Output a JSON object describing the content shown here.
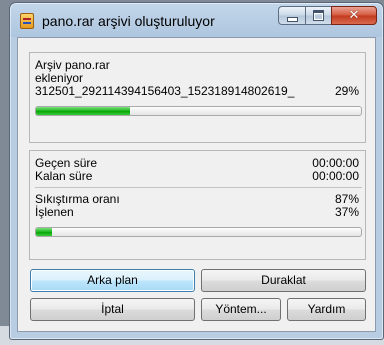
{
  "window": {
    "title": "pano.rar arşivi oluşturuluyor"
  },
  "icons": {
    "app": "winrar-archive-icon",
    "minimize": "minimize-icon",
    "maximize": "maximize-icon",
    "close": "close-icon",
    "close_glyph": "✕"
  },
  "archive": {
    "line1": "Arşiv pano.rar",
    "line2": "ekleniyor",
    "current_file": "312501_292114394156403_152318914802619_",
    "file_percent": "29%",
    "file_progress": 0.29
  },
  "stats": {
    "elapsed_label": "Geçen süre",
    "elapsed_value": "00:00:00",
    "remaining_label": "Kalan süre",
    "remaining_value": "00:00:00",
    "ratio_label": "Sıkıştırma oranı",
    "ratio_value": "87%",
    "processed_label": "İşlenen",
    "processed_value": "37%",
    "total_progress": 0.05
  },
  "buttons": {
    "background": "Arka plan",
    "pause": "Duraklat",
    "cancel": "İptal",
    "mode": "Yöntem...",
    "help": "Yardım"
  },
  "colors": {
    "progress_green": "#17b617",
    "focus_border": "#3c7fb1"
  }
}
